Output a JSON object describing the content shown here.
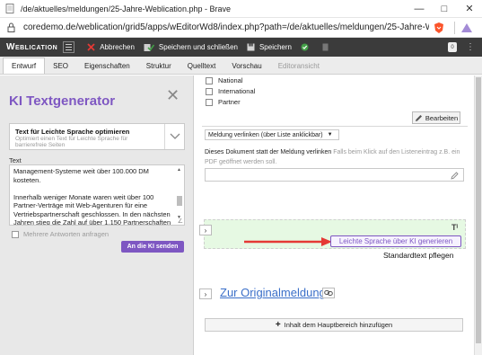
{
  "window": {
    "title": "/de/aktuelles/meldungen/25-Jahre-Weblication.php - Brave",
    "url": "coredemo.de/weblication/grid5/apps/wEditorWd8/index.php?path=/de/aktuelles/meldungen/25-Jahre-Weblica..."
  },
  "toolbar": {
    "logo": "Weblication",
    "cancel_label": "Abbrechen",
    "save_close_label": "Speichern und schließen",
    "save_label": "Speichern",
    "badge": "0"
  },
  "tabs": [
    {
      "label": "Entwurf",
      "active": true
    },
    {
      "label": "SEO"
    },
    {
      "label": "Eigenschaften"
    },
    {
      "label": "Struktur"
    },
    {
      "label": "Quelltext"
    },
    {
      "label": "Vorschau"
    },
    {
      "label": "Editoransicht",
      "disabled": true
    }
  ],
  "ki_panel": {
    "title": "KI Textgenerator",
    "dropdown_title": "Text für Leichte Sprache optimieren",
    "dropdown_desc": "Optimiert einen Text für Leichte Sprache für barrierefreie Seiten",
    "text_label": "Text",
    "text_paragraphs": [
      "Management-Systeme weit über 100.000 DM kosteten.",
      "Innerhalb weniger Monate waren weit über 100 Partner-Verträge mit Web-Agenturen für eine Vertriebspartnerschaft geschlossen. In den nächsten Jahren stieg die Zahl auf über 1.150 Partnerschaften"
    ],
    "multi_label": "Mehrere Antworten anfragen",
    "send_label": "An die KI senden"
  },
  "right": {
    "checkboxes": [
      "National",
      "International",
      "Partner"
    ],
    "edit_label": "Bearbeiten",
    "link_select": "Meldung verlinken (über Liste anklickbar)",
    "link_desc_main": "Dieses Dokument statt der Meldung verlinken",
    "link_desc_hint": "Falls beim Klick auf den Listeneintrag z.B. ein PDF geöffnet werden soll.",
    "leichte_button": "Leichte Sprache über KI generieren",
    "standardtext": "Standardtext pflegen",
    "original_link": "Zur Originalmeldung",
    "add_label": "Inhalt dem Hauptbereich hinzufügen"
  },
  "colors": {
    "accent": "#7e57c2",
    "toolbar_bg": "#3b3b3b",
    "green_bg": "#e6f9e3",
    "arrow": "#e53935",
    "link": "#3a6fc9"
  }
}
